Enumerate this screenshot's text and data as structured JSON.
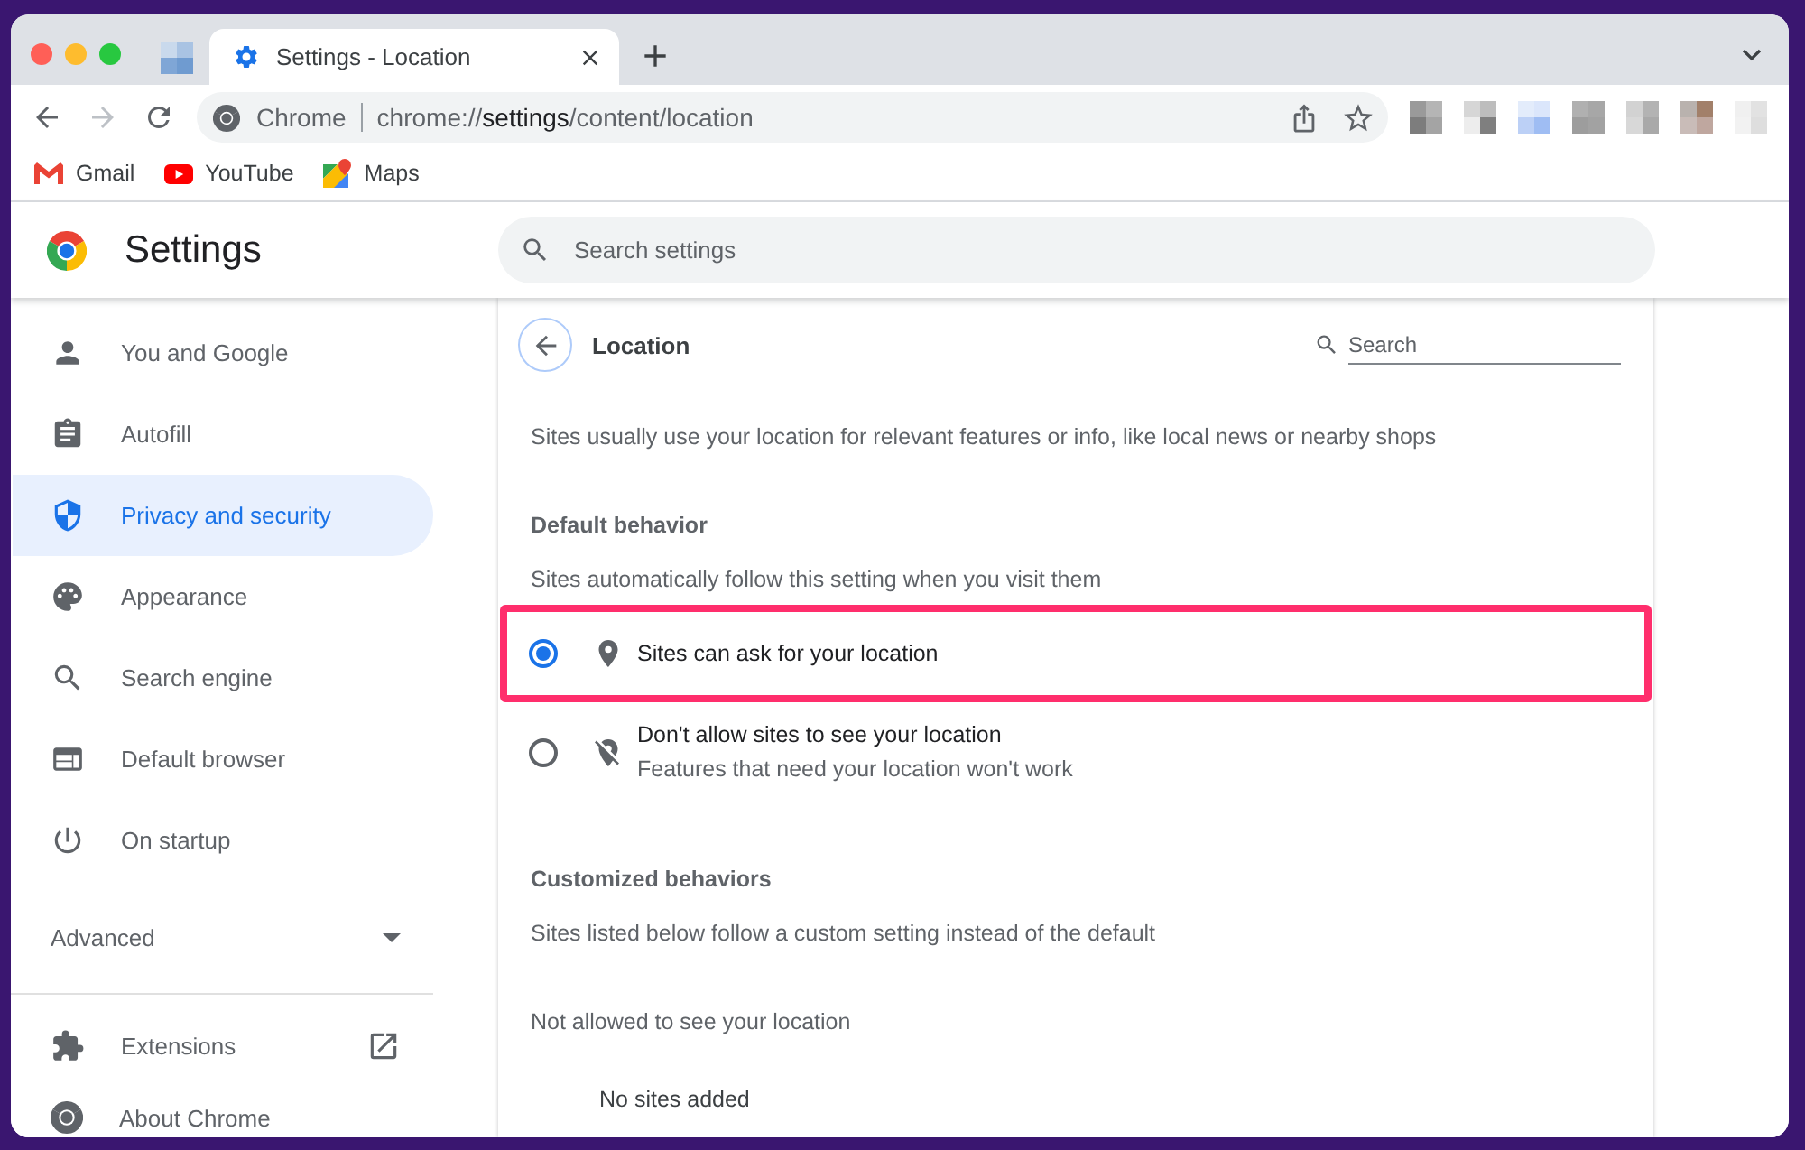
{
  "browser": {
    "tabs": [
      {
        "kind": "pinned",
        "selected": false
      },
      {
        "kind": "page",
        "title": "Settings - Location",
        "selected": true
      }
    ],
    "nav_buttons": [
      {
        "kind": "back",
        "disabled": false
      },
      {
        "kind": "forward",
        "disabled": true
      },
      {
        "kind": "reload",
        "disabled": false
      }
    ],
    "address_bar": {
      "site_label": "Chrome",
      "url_scheme": "chrome://",
      "url_host": "settings",
      "url_path": "/content/location"
    },
    "bookmarks": [
      {
        "kind": "mail",
        "label": "Gmail"
      },
      {
        "kind": "video",
        "label": "YouTube"
      },
      {
        "kind": "map",
        "label": "Maps"
      }
    ]
  },
  "settings": {
    "title": "Settings",
    "search": {
      "placeholder": "Search settings"
    },
    "sidebar": {
      "items": [
        {
          "kind": "person",
          "label": "You and Google",
          "selected": false
        },
        {
          "kind": "clipboard",
          "label": "Autofill",
          "selected": false
        },
        {
          "kind": "shield",
          "label": "Privacy and security",
          "selected": true
        },
        {
          "kind": "palette",
          "label": "Appearance",
          "selected": false
        },
        {
          "kind": "search",
          "label": "Search engine",
          "selected": false
        },
        {
          "kind": "browser",
          "label": "Default browser",
          "selected": false
        },
        {
          "kind": "power",
          "label": "On startup",
          "selected": false
        }
      ],
      "advanced": {
        "label": "Advanced",
        "expanded": false
      },
      "links": [
        {
          "kind": "puzzle",
          "label": "Extensions",
          "external": true
        },
        {
          "kind": "logo",
          "label": "About Chrome",
          "external": false
        }
      ]
    },
    "page": {
      "title": "Location",
      "search": {
        "placeholder": "Search"
      },
      "description": "Sites usually use your location for relevant features or info, like local news or nearby shops",
      "default_behavior": {
        "heading": "Default behavior",
        "description": "Sites automatically follow this setting when you visit them",
        "options": [
          {
            "kind": "allow",
            "label": "Sites can ask for your location",
            "selected": true,
            "highlighted": true
          },
          {
            "kind": "block",
            "label": "Don't allow sites to see your location",
            "sublabel": "Features that need your location won't work",
            "selected": false,
            "highlighted": false
          }
        ]
      },
      "customized_behaviors": {
        "heading": "Customized behaviors",
        "description": "Sites listed below follow a custom setting instead of the default",
        "lists": [
          {
            "title": "Not allowed to see your location",
            "empty_text": "No sites added"
          }
        ]
      }
    }
  }
}
